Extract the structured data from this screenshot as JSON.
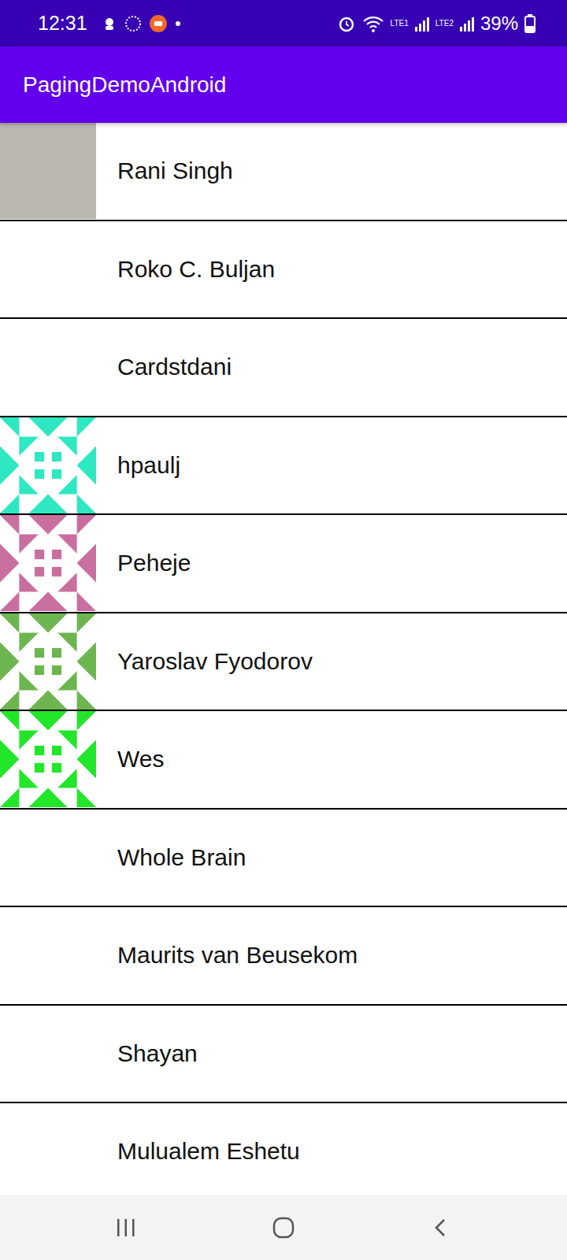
{
  "status_bar": {
    "time": "12:31",
    "signals": [
      "LTE1",
      "LTE2"
    ],
    "battery": "39%",
    "battery_level": 0.39
  },
  "app_bar": {
    "title": "PagingDemoAndroid"
  },
  "list": [
    {
      "name": "Rani Singh",
      "kind": "photo"
    },
    {
      "name": "Roko C. Buljan",
      "kind": "none"
    },
    {
      "name": "Cardstdani",
      "kind": "none"
    },
    {
      "name": "hpaulj",
      "kind": "identicon",
      "color": "#2ee8c2"
    },
    {
      "name": "Peheje",
      "kind": "identicon",
      "color": "#c96f9f"
    },
    {
      "name": "Yaroslav Fyodorov",
      "kind": "identicon",
      "color": "#6db64f"
    },
    {
      "name": "Wes",
      "kind": "identicon",
      "color": "#22e62a"
    },
    {
      "name": "Whole Brain",
      "kind": "none"
    },
    {
      "name": "Maurits van Beusekom",
      "kind": "none"
    },
    {
      "name": "Shayan",
      "kind": "none"
    },
    {
      "name": "Mulualem Eshetu",
      "kind": "none"
    }
  ]
}
